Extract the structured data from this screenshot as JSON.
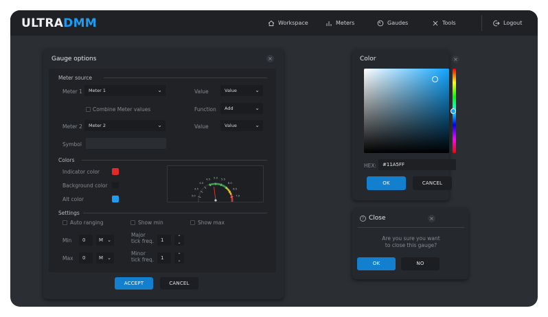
{
  "header": {
    "logo_a": "ULTRA",
    "logo_b": "DMM",
    "nav": [
      "Workspace",
      "Meters",
      "Gaudes",
      "Tools"
    ],
    "logout": "Logout"
  },
  "gauge_options": {
    "title": "Gauge options",
    "meter_source": "Meter source",
    "meter1_label": "Meter 1",
    "meter1_value": "Meter 1",
    "value1_label": "Value",
    "value1_value": "Value",
    "combine_label": "Combine Meter values",
    "function_label": "Function",
    "function_value": "Add",
    "meter2_label": "Meter 2",
    "meter2_value": "Meter 2",
    "value2_label": "Value",
    "value2_value": "Value",
    "symbol_label": "Symbol",
    "colors": "Colors",
    "indicator_label": "Indicator color",
    "background_label": "Background color",
    "alt_label": "Alt color",
    "indicator_color": "#e02a2a",
    "background_color": "#1a1c1f",
    "alt_color": "#1e9cf0",
    "settings": "Settings",
    "auto_ranging": "Auto ranging",
    "show_min": "Show min",
    "show_max": "Show max",
    "min_label": "Min",
    "min_value": "0",
    "min_unit": "M",
    "max_label": "Max",
    "max_value": "0",
    "max_unit": "M",
    "major_label_1": "Major",
    "major_label_2": "tick freq.",
    "major_value": "1",
    "minor_label_1": "Minor",
    "minor_label_2": "tick freq.",
    "minor_value": "1",
    "accept": "ACCEPT",
    "cancel": "CANCEL",
    "gauge_ticks": [
      "2.0",
      "2.5",
      "3.0",
      "3.5",
      "4.0",
      "4.5",
      "5.0",
      "5.5",
      "6.0",
      "6.5",
      "7.0",
      "7.5",
      "8.0"
    ]
  },
  "color_panel": {
    "title": "Color",
    "hex_label": "HEX:",
    "hex_value": "#11A5FF",
    "ok": "OK",
    "cancel": "CANCEL"
  },
  "close_panel": {
    "title": "Close",
    "message_1": "Are you sure you want",
    "message_2": "to close this gauge?",
    "ok": "OK",
    "no": "NO"
  }
}
